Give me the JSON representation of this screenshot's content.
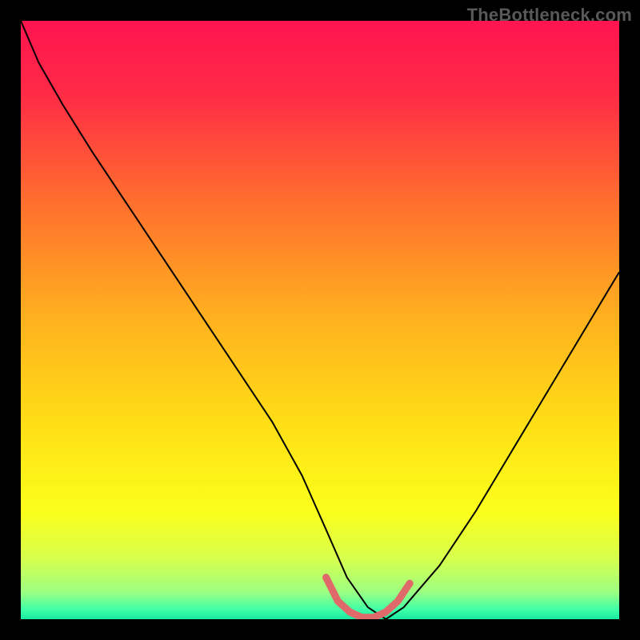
{
  "watermark": "TheBottleneck.com",
  "chart_data": {
    "type": "line",
    "title": "",
    "xlabel": "",
    "ylabel": "",
    "xlim": [
      0,
      100
    ],
    "ylim": [
      0,
      100
    ],
    "legend": false,
    "grid": false,
    "background_gradient": {
      "stops": [
        {
          "offset": 0.0,
          "color": "#ff1450"
        },
        {
          "offset": 0.12,
          "color": "#ff2a46"
        },
        {
          "offset": 0.3,
          "color": "#ff6e2e"
        },
        {
          "offset": 0.5,
          "color": "#ffb21e"
        },
        {
          "offset": 0.68,
          "color": "#ffe016"
        },
        {
          "offset": 0.82,
          "color": "#fbff1a"
        },
        {
          "offset": 0.9,
          "color": "#d6ff4e"
        },
        {
          "offset": 0.955,
          "color": "#9cff82"
        },
        {
          "offset": 0.985,
          "color": "#3cffa8"
        },
        {
          "offset": 1.0,
          "color": "#18e8a0"
        }
      ]
    },
    "series": [
      {
        "name": "bottleneck-curve",
        "color": "#000000",
        "stroke_width": 2,
        "x": [
          0,
          3,
          7,
          12,
          18,
          24,
          30,
          36,
          42,
          47,
          51,
          54.5,
          58,
          61,
          64,
          70,
          76,
          82,
          88,
          94,
          100
        ],
        "y": [
          100,
          93,
          86,
          78,
          69,
          60,
          51,
          42,
          33,
          24,
          15,
          7,
          2,
          0,
          2,
          9,
          18,
          28,
          38,
          48,
          58
        ]
      },
      {
        "name": "trough-highlight",
        "color": "#e06a6a",
        "stroke_width": 9,
        "linecap": "round",
        "x": [
          51,
          53,
          55,
          57,
          59,
          61,
          63,
          65
        ],
        "y": [
          7,
          3,
          1.2,
          0.3,
          0.3,
          1.2,
          3,
          6
        ]
      }
    ]
  }
}
